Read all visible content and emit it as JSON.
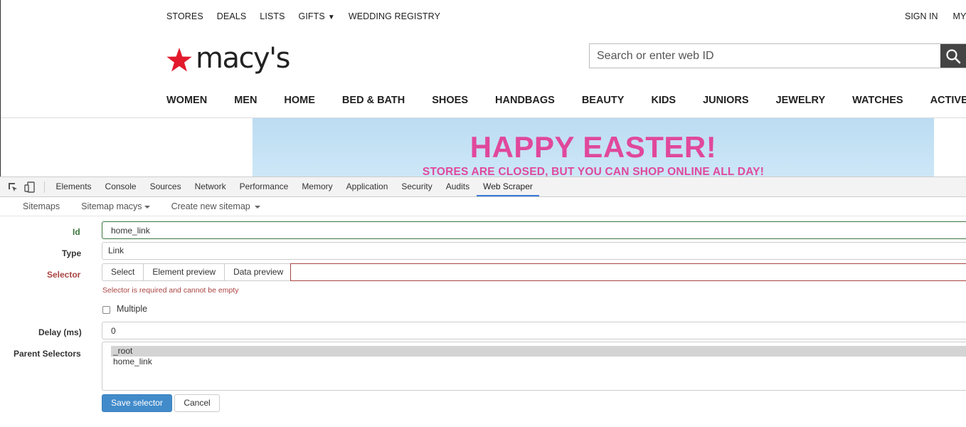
{
  "site": {
    "utility_nav": [
      {
        "label": "STORES"
      },
      {
        "label": "DEALS"
      },
      {
        "label": "LISTS"
      },
      {
        "label": "GIFTS"
      },
      {
        "label": "WEDDING REGISTRY"
      }
    ],
    "gifts_arrow": "▼",
    "account_nav": [
      {
        "label": "SIGN IN"
      },
      {
        "label": "MY A"
      }
    ],
    "logo_text": "macy's",
    "search_placeholder": "Search or enter web ID",
    "main_nav": [
      {
        "label": "WOMEN"
      },
      {
        "label": "MEN"
      },
      {
        "label": "HOME"
      },
      {
        "label": "BED & BATH"
      },
      {
        "label": "SHOES"
      },
      {
        "label": "HANDBAGS"
      },
      {
        "label": "BEAUTY"
      },
      {
        "label": "KIDS"
      },
      {
        "label": "JUNIORS"
      },
      {
        "label": "JEWELRY"
      },
      {
        "label": "WATCHES"
      },
      {
        "label": "ACTIVE"
      }
    ],
    "banner": {
      "title": "HAPPY EASTER!",
      "subtitle": "STORES ARE CLOSED, BUT YOU CAN SHOP ONLINE ALL DAY!"
    },
    "colors": {
      "brand_red": "#e21a2c",
      "banner_pink": "#e0489c"
    }
  },
  "devtools": {
    "tabs": [
      {
        "label": "Elements"
      },
      {
        "label": "Console"
      },
      {
        "label": "Sources"
      },
      {
        "label": "Network"
      },
      {
        "label": "Performance"
      },
      {
        "label": "Memory"
      },
      {
        "label": "Application"
      },
      {
        "label": "Security"
      },
      {
        "label": "Audits"
      },
      {
        "label": "Web Scraper"
      }
    ],
    "active_tab": "Web Scraper",
    "tool_icons": [
      "inspect-icon",
      "device-toolbar-icon"
    ]
  },
  "scraper": {
    "nav": {
      "sitemaps": "Sitemaps",
      "sitemap_current": "Sitemap macys",
      "create_new": "Create new sitemap"
    },
    "form": {
      "id_label": "Id",
      "id_value": "home_link",
      "type_label": "Type",
      "type_value": "Link",
      "selector_label": "Selector",
      "selector_buttons": [
        "Select",
        "Element preview",
        "Data preview"
      ],
      "selector_value": "",
      "selector_error": "Selector is required and cannot be empty",
      "multiple_label": "Multiple",
      "multiple_checked": false,
      "delay_label": "Delay (ms)",
      "delay_value": "0",
      "parent_label": "Parent Selectors",
      "parent_options": [
        {
          "label": "_root",
          "selected": true
        },
        {
          "label": "home_link",
          "selected": false
        }
      ],
      "save_button": "Save selector",
      "cancel_button": "Cancel"
    }
  }
}
